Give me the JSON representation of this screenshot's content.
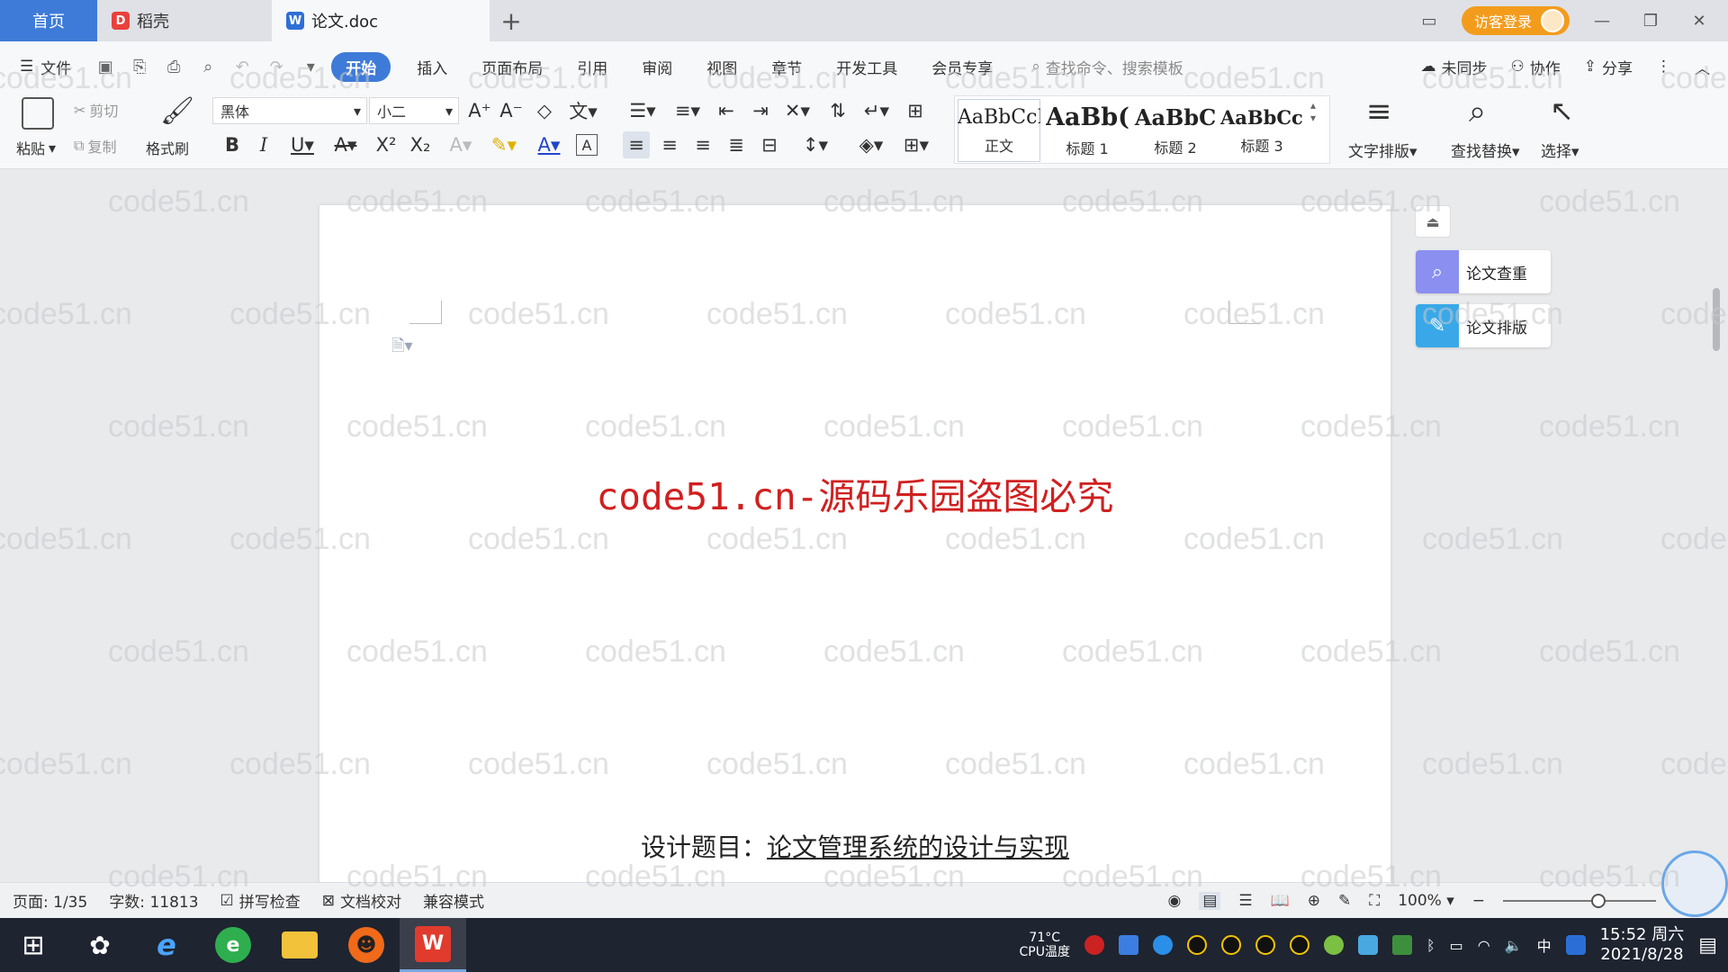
{
  "tabs": {
    "home": "首页",
    "daoke": "稻壳",
    "doc": "论文.doc",
    "add": "+"
  },
  "header": {
    "login": "访客登录"
  },
  "menu": {
    "file": "文件",
    "items": [
      "开始",
      "插入",
      "页面布局",
      "引用",
      "审阅",
      "视图",
      "章节",
      "开发工具",
      "会员专享"
    ],
    "search_placeholder": "查找命令、搜索模板",
    "sync": "未同步",
    "collab": "协作",
    "share": "分享"
  },
  "ribbon": {
    "paste": "粘贴",
    "cut": "剪切",
    "copy": "复制",
    "format_painter": "格式刷",
    "font_family": "黑体",
    "font_size": "小二",
    "styles": [
      {
        "sample": "AaBbCcI",
        "name": "正文",
        "bold": false
      },
      {
        "sample": "AaBb(",
        "name": "标题 1",
        "bold": true
      },
      {
        "sample": "AaBbC",
        "name": "标题 2",
        "bold": true
      },
      {
        "sample": "AaBbCcl",
        "name": "标题 3",
        "bold": true
      }
    ],
    "text_layout": "文字排版",
    "find_replace": "查找替换",
    "select": "选择"
  },
  "document": {
    "watermark_red": "code51.cn-源码乐园盗图必究",
    "design_prefix": "设计题目：",
    "design_title": "论文管理系统的设计与实现"
  },
  "side_panel": {
    "check": "论文查重",
    "layout": "论文排版"
  },
  "status": {
    "page": "页面: 1/35",
    "words": "字数: 11813",
    "spell": "拼写检查",
    "proof": "文档校对",
    "compat": "兼容模式",
    "zoom": "100%"
  },
  "taskbar": {
    "temp": "71°C",
    "temp_label": "CPU温度",
    "ime": "中",
    "time": "15:52 周六",
    "date": "2021/8/28"
  },
  "watermark": "code51.cn",
  "colors": {
    "accent": "#3e7bd8",
    "login": "#f39c1c",
    "red_text": "#d02020",
    "taskbar": "#1e2430"
  }
}
